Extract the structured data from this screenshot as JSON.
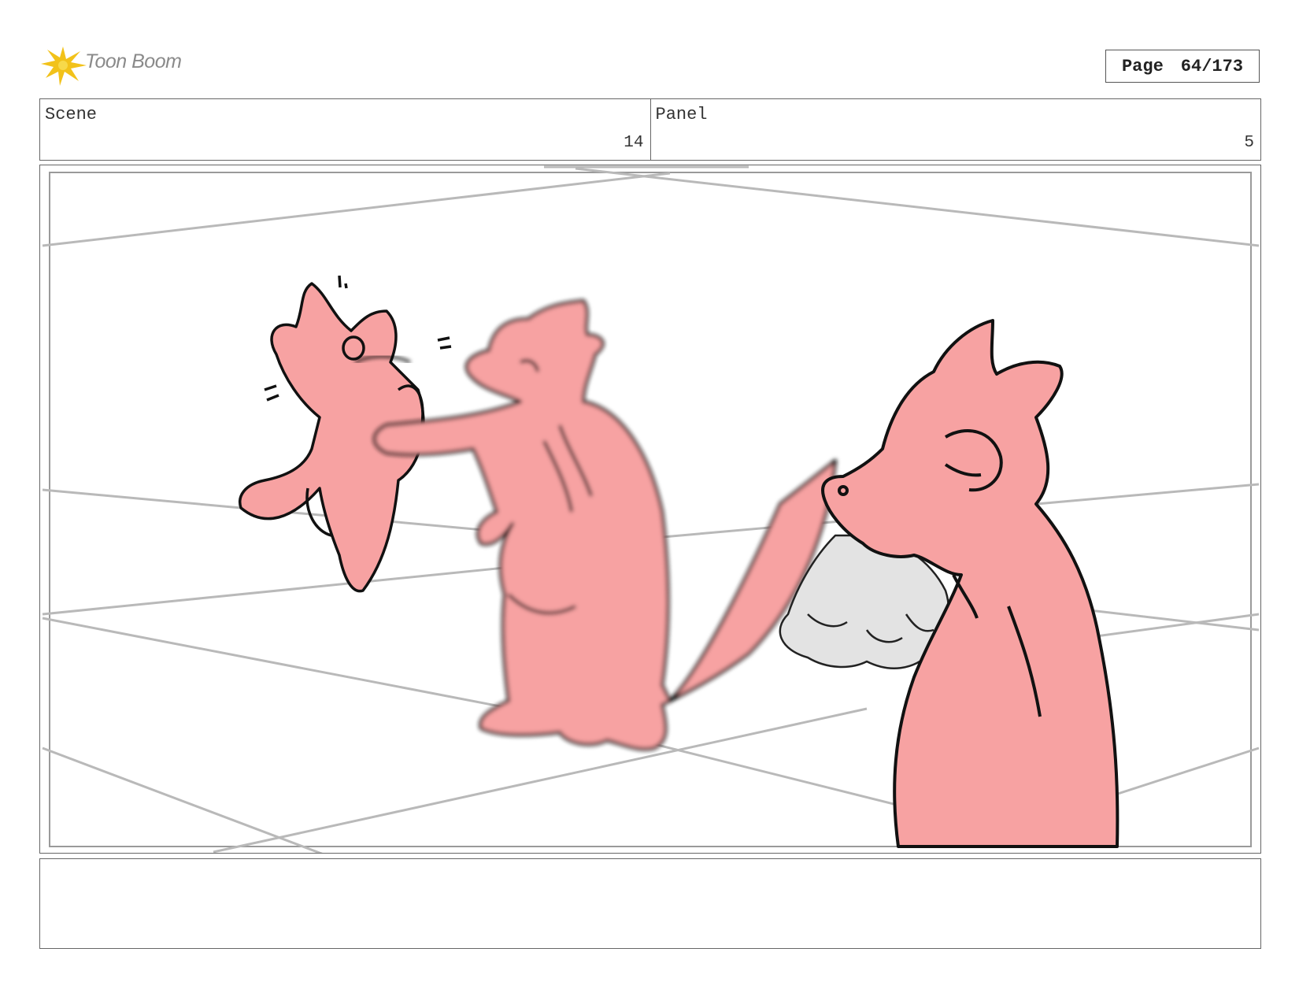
{
  "header": {
    "brand": "Toon Boom",
    "page_label": "Page",
    "page_value": "64/173"
  },
  "info": {
    "scene_label": "Scene",
    "scene_value": "14",
    "panel_label": "Panel",
    "panel_value": "5"
  },
  "colors": {
    "character_fill": "#f7a2a2",
    "outline": "#111111",
    "guide_lines": "#b9b9b9",
    "logo_accent": "#f2c21a",
    "rock": "#e3e3e3"
  },
  "caption": {
    "text": ""
  }
}
